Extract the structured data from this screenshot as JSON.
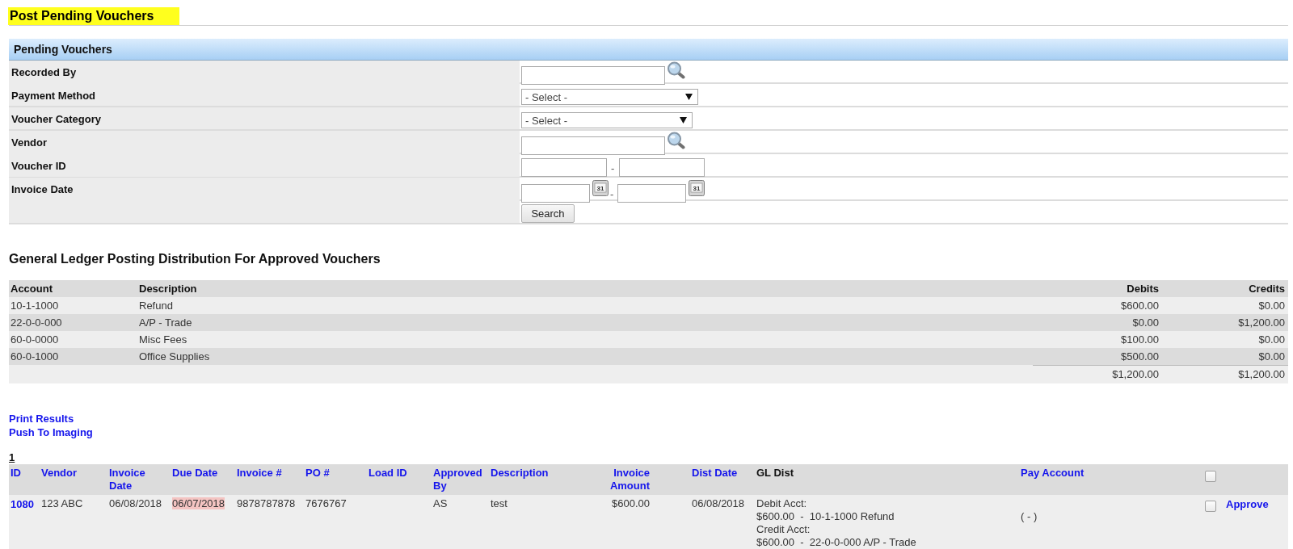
{
  "page": {
    "title": "Post Pending Vouchers"
  },
  "search_panel": {
    "title": "Pending Vouchers",
    "fields": [
      {
        "kind": "lookup",
        "label": "Recorded By"
      },
      {
        "kind": "select",
        "label": "Payment Method",
        "value": "- Select -"
      },
      {
        "kind": "select",
        "label": "Voucher Category",
        "value": "- Select -"
      },
      {
        "kind": "lookup",
        "label": "Vendor"
      },
      {
        "kind": "range",
        "label": "Voucher ID",
        "separator": "-"
      },
      {
        "kind": "date_range",
        "label": "Invoice Date",
        "separator": "-",
        "calendar_texts": [
          "31",
          "31"
        ]
      }
    ],
    "search_button": "Search"
  },
  "gl_distribution": {
    "title": "General Ledger Posting Distribution For Approved Vouchers",
    "columns": [
      "Account",
      "Description",
      "Debits",
      "Credits"
    ],
    "rows": [
      {
        "account": "10-1-1000",
        "description": "Refund",
        "debits": "$600.00",
        "credits": "$0.00"
      },
      {
        "account": "22-0-0-000",
        "description": "A/P - Trade",
        "debits": "$0.00",
        "credits": "$1,200.00"
      },
      {
        "account": "60-0-0000",
        "description": "Misc Fees",
        "debits": "$100.00",
        "credits": "$0.00"
      },
      {
        "account": "60-0-1000",
        "description": "Office Supplies",
        "debits": "$500.00",
        "credits": "$0.00"
      }
    ],
    "totals": {
      "debits": "$1,200.00",
      "credits": "$1,200.00"
    }
  },
  "actions": [
    "Print Results",
    "Push To Imaging"
  ],
  "pager": [
    "1"
  ],
  "vouchers": {
    "columns": [
      {
        "label": "ID",
        "sortable": true
      },
      {
        "label": "Vendor",
        "sortable": true
      },
      {
        "label": "Invoice Date",
        "sortable": true
      },
      {
        "label": "Due Date",
        "sortable": true
      },
      {
        "label": "Invoice #",
        "sortable": true
      },
      {
        "label": "PO #",
        "sortable": true
      },
      {
        "label": "Load ID",
        "sortable": true
      },
      {
        "label": "Approved By",
        "sortable": true
      },
      {
        "label": "Description",
        "sortable": true
      },
      {
        "label": "Invoice Amount",
        "sortable": true
      },
      {
        "label": "Dist Date",
        "sortable": true
      },
      {
        "label": "GL Dist",
        "sortable": false
      },
      {
        "label": "Pay Account",
        "sortable": true
      }
    ],
    "select_all": {
      "checked": false
    },
    "rows": [
      {
        "id": "1080",
        "vendor": "123 ABC",
        "invoice_date": "06/08/2018",
        "due_date": "06/07/2018",
        "overdue": true,
        "invoice_number": "9878787878",
        "po_number": "7676767",
        "approved_by": "AS",
        "description": "test",
        "invoice_amount": "$600.00",
        "dist_date": "06/08/2018",
        "gl_dist": [
          "Debit Acct:",
          "$600.00  -  10-1-1000 Refund",
          "Credit Acct:",
          "$600.00  -  22-0-0-000 A/P - Trade"
        ],
        "pay_account": "( - )",
        "checked": false,
        "action": "Approve"
      }
    ]
  }
}
